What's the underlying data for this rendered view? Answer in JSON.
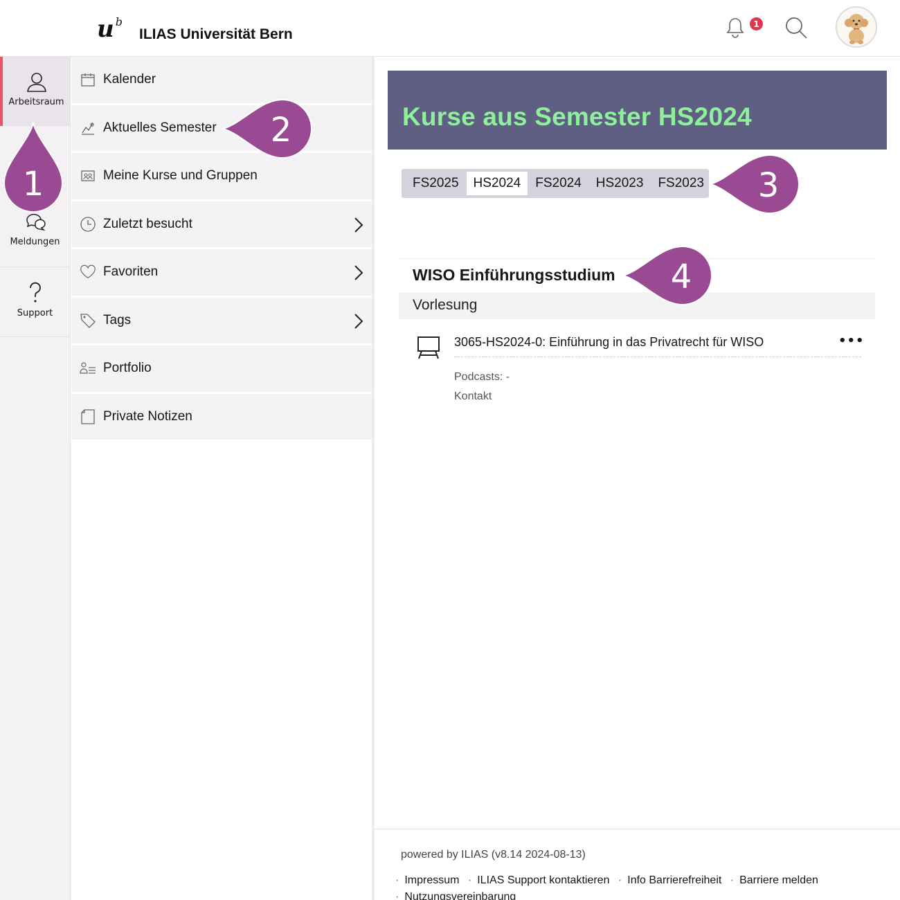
{
  "header": {
    "logo_letter": "u",
    "logo_sup": "b",
    "app_title": "ILIAS Universität Bern",
    "notification_count": "1"
  },
  "mainbar": {
    "items": [
      {
        "label": "Arbeitsraum"
      },
      {
        "label": "Meldungen"
      },
      {
        "label": "Support"
      }
    ]
  },
  "slate": {
    "items": [
      {
        "label": "Kalender"
      },
      {
        "label": "Aktuelles Semester"
      },
      {
        "label": "Meine Kurse und Gruppen"
      },
      {
        "label": "Zuletzt besucht"
      },
      {
        "label": "Favoriten"
      },
      {
        "label": "Tags"
      },
      {
        "label": "Portfolio"
      },
      {
        "label": "Private Notizen"
      }
    ]
  },
  "content": {
    "title": "Kurse aus Semester HS2024",
    "tabs": [
      {
        "label": "FS2025"
      },
      {
        "label": "HS2024"
      },
      {
        "label": "FS2024"
      },
      {
        "label": "HS2023"
      },
      {
        "label": "FS2023"
      }
    ],
    "active_tab": "HS2024",
    "group_title": "WISO Einführungsstudium",
    "subgroup_title": "Vorlesung",
    "course": {
      "title": "3065-HS2024-0: Einführung in das Privatrecht für WISO",
      "actions": "•••",
      "prop_podcasts": "Podcasts: -",
      "prop_contact": "Kontakt"
    }
  },
  "footer": {
    "powered": "powered by ILIAS (v8.14 2024-08-13)",
    "links": [
      "Impressum",
      "ILIAS Support kontaktieren",
      "Info Barrierefreiheit",
      "Barriere melden",
      "Nutzungsvereinbarung"
    ]
  },
  "callouts": [
    "1",
    "2",
    "3",
    "4"
  ],
  "colors": {
    "callout": "#9a4a92",
    "banner": "#5f5f84",
    "banner_title": "#8ef09a",
    "active_indicator": "#e8546a",
    "badge": "#e0374e"
  }
}
